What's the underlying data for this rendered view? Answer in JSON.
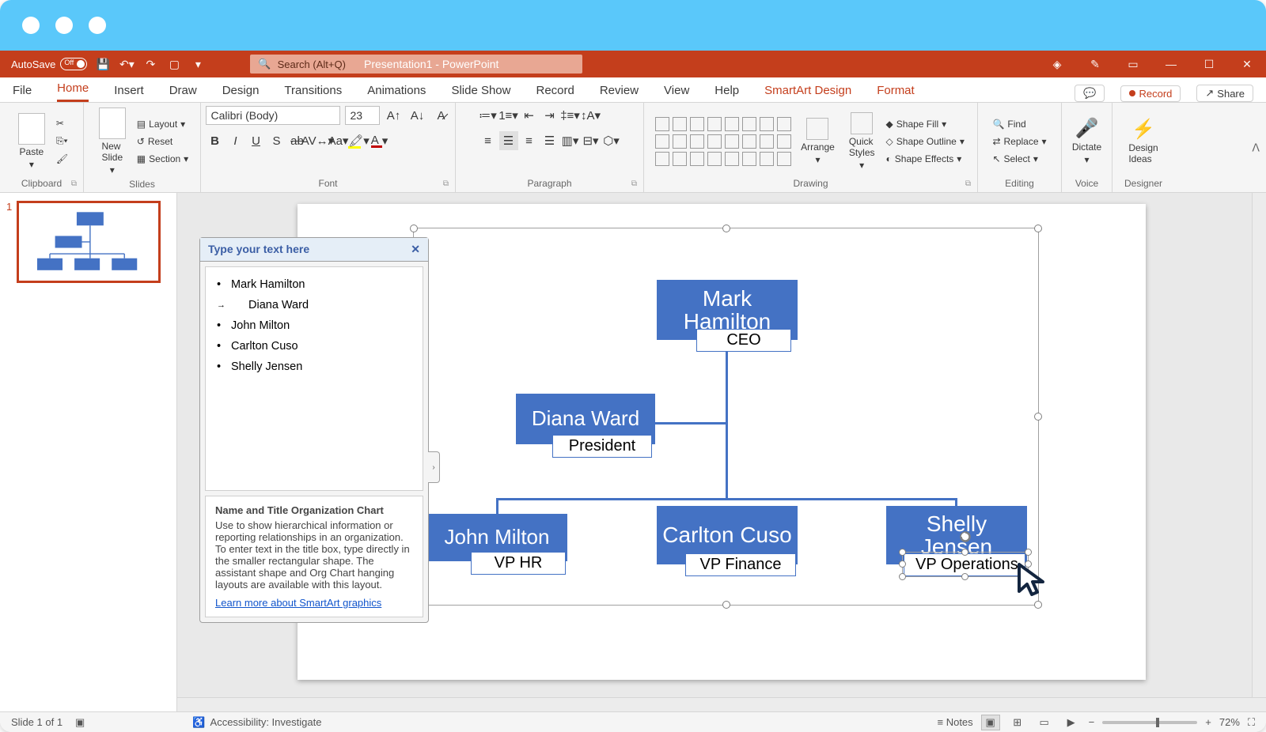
{
  "titlebar": {
    "autosave_label": "AutoSave",
    "autosave_state": "Off",
    "doc_title": "Presentation1 - PowerPoint",
    "search_placeholder": "Search (Alt+Q)"
  },
  "tabs": {
    "file": "File",
    "home": "Home",
    "insert": "Insert",
    "draw": "Draw",
    "design": "Design",
    "transitions": "Transitions",
    "animations": "Animations",
    "slideshow": "Slide Show",
    "record": "Record",
    "review": "Review",
    "view": "View",
    "help": "Help",
    "smartart": "SmartArt Design",
    "format": "Format",
    "record_btn": "Record",
    "share_btn": "Share"
  },
  "ribbon": {
    "clipboard": {
      "paste": "Paste",
      "label": "Clipboard"
    },
    "slides": {
      "new_slide": "New\nSlide",
      "layout": "Layout",
      "reset": "Reset",
      "section": "Section",
      "label": "Slides"
    },
    "font": {
      "name": "Calibri (Body)",
      "size": "23",
      "label": "Font"
    },
    "paragraph": {
      "label": "Paragraph"
    },
    "drawing": {
      "arrange": "Arrange",
      "quick_styles": "Quick\nStyles",
      "shape_fill": "Shape Fill",
      "shape_outline": "Shape Outline",
      "shape_effects": "Shape Effects",
      "label": "Drawing"
    },
    "editing": {
      "find": "Find",
      "replace": "Replace",
      "select": "Select",
      "label": "Editing"
    },
    "voice": {
      "dictate": "Dictate",
      "label": "Voice"
    },
    "designer": {
      "ideas": "Design\nIdeas",
      "label": "Designer"
    }
  },
  "thumb": {
    "num": "1"
  },
  "textpane": {
    "header": "Type your text here",
    "items": [
      "Mark Hamilton",
      "Diana Ward",
      "John Milton",
      "Carlton Cuso",
      "Shelly Jensen"
    ],
    "desc_title": "Name and Title Organization Chart",
    "desc_body": "Use to show hierarchical information or reporting relationships in an organization. To enter text in the title box, type directly in the smaller rectangular shape. The assistant shape and Org Chart hanging layouts are available with this layout.",
    "desc_link": "Learn more about SmartArt graphics"
  },
  "org": {
    "ceo": {
      "name": "Mark Hamilton",
      "title": "CEO"
    },
    "assist": {
      "name": "Diana Ward",
      "title": "President"
    },
    "c1": {
      "name": "John Milton",
      "title": "VP HR"
    },
    "c2": {
      "name": "Carlton Cuso",
      "title": "VP Finance"
    },
    "c3": {
      "name": "Shelly Jensen",
      "title": "VP Operations"
    }
  },
  "status": {
    "slide": "Slide 1 of 1",
    "a11y": "Accessibility: Investigate",
    "notes": "Notes",
    "zoom": "72%"
  }
}
